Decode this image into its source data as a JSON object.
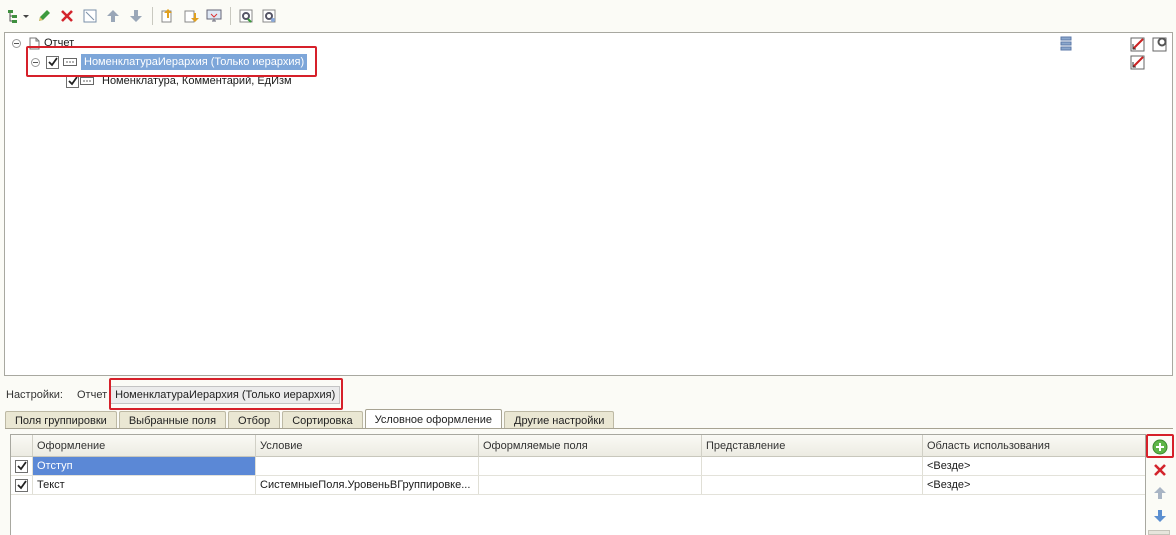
{
  "toolbar": {
    "buttons": [
      {
        "name": "add-grouping",
        "icon": "tree-add-icon"
      },
      {
        "name": "edit",
        "icon": "pencil-icon"
      },
      {
        "name": "delete",
        "icon": "red-x-icon"
      },
      {
        "name": "toggle-use",
        "icon": "check-box-icon"
      },
      {
        "name": "move-up",
        "icon": "arrow-up-icon"
      },
      {
        "name": "move-down",
        "icon": "arrow-down-icon"
      },
      {
        "name": "group-up",
        "icon": "level-up-icon"
      },
      {
        "name": "group-down",
        "icon": "level-down-icon"
      },
      {
        "name": "current-item",
        "icon": "monitor-icon"
      },
      {
        "name": "settings",
        "icon": "gear-icon"
      },
      {
        "name": "settings-alt",
        "icon": "gear-search-icon"
      }
    ]
  },
  "tree": {
    "root_label": "Отчет",
    "grouping_label": "НоменклатураИерархия (Только иерархия)",
    "detail_label": "Номенклатура, Комментарий, ЕдИзм"
  },
  "settings": {
    "label": "Настройки:",
    "crumb_report": "Отчет",
    "crumb_active": "НоменклатураИерархия (Только иерархия)"
  },
  "tabs": [
    {
      "label": "Поля группировки",
      "active": false
    },
    {
      "label": "Выбранные поля",
      "active": false
    },
    {
      "label": "Отбор",
      "active": false
    },
    {
      "label": "Сортировка",
      "active": false
    },
    {
      "label": "Условное оформление",
      "active": true
    },
    {
      "label": "Другие настройки",
      "active": false
    }
  ],
  "grid": {
    "headers": [
      "Оформление",
      "Условие",
      "Оформляемые поля",
      "Представление",
      "Область использования"
    ],
    "rows": [
      {
        "checked": true,
        "design": "Отступ",
        "condition": "",
        "fields": "",
        "presentation": "",
        "area": "<Везде>"
      },
      {
        "checked": true,
        "design": "Текст",
        "condition": "СистемныеПоля.УровеньВГруппировке...",
        "fields": "",
        "presentation": "",
        "area": "<Везде>"
      }
    ]
  },
  "colors": {
    "highlight": "#d6202a",
    "selection": "#5b88d6",
    "tree_selection": "#7da6d9",
    "tab_bg": "#eae7d3"
  }
}
